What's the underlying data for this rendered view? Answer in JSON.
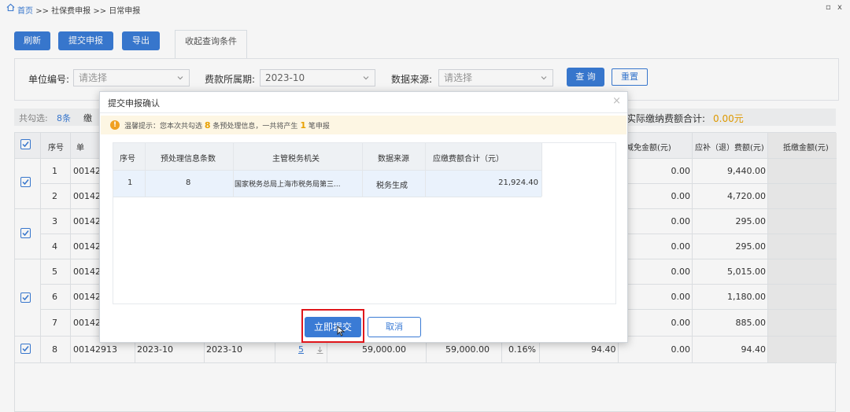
{
  "breadcrumb": {
    "home": "首页",
    "sep1": ">>",
    "level2": "社保费申报",
    "sep2": ">>",
    "current": "日常申报"
  },
  "window": {
    "minimize": "▫",
    "close": "x"
  },
  "toolbar": {
    "refresh": "刷新",
    "submit": "提交申报",
    "export": "导出",
    "tab": "收起查询条件"
  },
  "filters": {
    "unit_label": "单位编号:",
    "unit_placeholder": "请选择",
    "period_label": "费款所属期:",
    "period_value": "2023-10",
    "source_label": "数据来源:",
    "source_placeholder": "请选择",
    "query": "查 询",
    "reset": "重置"
  },
  "summary": {
    "selected_label": "共勾选:",
    "selected_count": "8条",
    "cut_text": "缴",
    "actual_label": "实际缴纳费额合计:",
    "actual_value": "0.00元"
  },
  "table": {
    "headers": [
      "序号",
      "单",
      "减免金额(元)",
      "应补（退）费额(元)",
      "抵缴金额(元)"
    ],
    "rows": [
      {
        "no": "1",
        "unit": "00142",
        "reduce": "0.00",
        "due": "9,440.00"
      },
      {
        "no": "2",
        "unit": "00142",
        "reduce": "0.00",
        "due": "4,720.00"
      },
      {
        "no": "3",
        "unit": "00142",
        "reduce": "0.00",
        "due": "295.00"
      },
      {
        "no": "4",
        "unit": "00142",
        "reduce": "0.00",
        "due": "295.00"
      },
      {
        "no": "5",
        "unit": "00142",
        "reduce": "0.00",
        "due": "5,015.00"
      },
      {
        "no": "6",
        "unit": "00142",
        "reduce": "0.00",
        "due": "1,180.00"
      },
      {
        "no": "7",
        "unit": "00142",
        "reduce": "0.00",
        "due": "885.00"
      },
      {
        "no": "8",
        "unit": "00142913",
        "period_start": "2023-10",
        "period_end": "2023-10",
        "count": "5",
        "base": "59,000.00",
        "base2": "59,000.00",
        "rate": "0.16%",
        "fee": "94.40",
        "reduce": "0.00",
        "due": "94.40"
      }
    ]
  },
  "modal": {
    "title": "提交申报确认",
    "close": "×",
    "notice_prefix": "温馨提示：您本次共勾选",
    "notice_count": "8",
    "notice_mid": "条预处理信息，一共将产生",
    "notice_num": "1",
    "notice_suffix": "笔申报",
    "headers": [
      "序号",
      "预处理信息条数",
      "主管税务机关",
      "数据来源",
      "应缴费额合计（元）"
    ],
    "row": {
      "no": "1",
      "count": "8",
      "org": "国家税务总局上海市税务局第三...",
      "source": "税务生成",
      "total": "21,924.40"
    },
    "submit": "立即提交",
    "cancel": "取消"
  }
}
